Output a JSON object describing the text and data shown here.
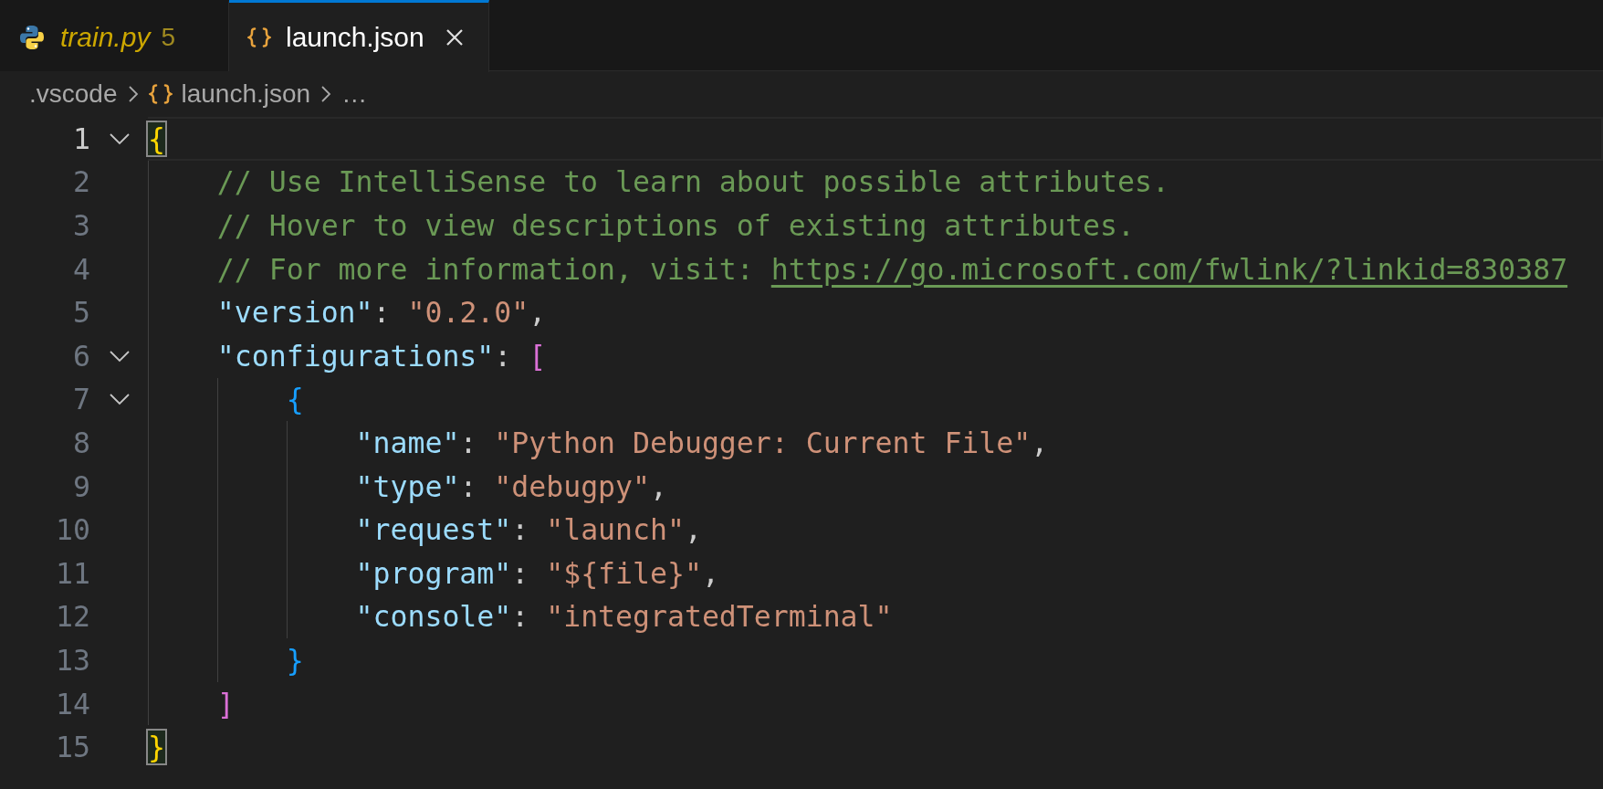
{
  "tabs": [
    {
      "label": "train.py",
      "kind": "python",
      "badge": "5",
      "preview": true,
      "selected": false,
      "closable": false
    },
    {
      "label": "launch.json",
      "kind": "json",
      "preview": false,
      "selected": true,
      "closable": true
    }
  ],
  "breadcrumb": [
    {
      "label": ".vscode",
      "kind": "folder"
    },
    {
      "label": "launch.json",
      "kind": "json"
    },
    {
      "label": "…",
      "kind": "symbols"
    }
  ],
  "lines": [
    {
      "number": "1",
      "fold": true,
      "current": true,
      "tokens": [
        {
          "kind": "bracket1",
          "text": "{",
          "matched": true
        }
      ]
    },
    {
      "number": "2",
      "fold": false,
      "current": false,
      "tokens": [
        {
          "kind": "comment",
          "text": "    // Use IntelliSense to learn about possible attributes."
        }
      ]
    },
    {
      "number": "3",
      "fold": false,
      "current": false,
      "tokens": [
        {
          "kind": "comment",
          "text": "    // Hover to view descriptions of existing attributes."
        }
      ]
    },
    {
      "number": "4",
      "fold": false,
      "current": false,
      "tokens": [
        {
          "kind": "comment",
          "text": "    // For more information, visit: "
        },
        {
          "kind": "link",
          "text": "https://go.microsoft.com/fwlink/?linkid=830387"
        }
      ]
    },
    {
      "number": "5",
      "fold": false,
      "current": false,
      "tokens": [
        {
          "kind": "key",
          "text": "    \"version\""
        },
        {
          "kind": "punct",
          "text": ": "
        },
        {
          "kind": "string",
          "text": "\"0.2.0\""
        },
        {
          "kind": "punct",
          "text": ","
        }
      ]
    },
    {
      "number": "6",
      "fold": true,
      "current": false,
      "tokens": [
        {
          "kind": "key",
          "text": "    \"configurations\""
        },
        {
          "kind": "punct",
          "text": ": "
        },
        {
          "kind": "bracket2",
          "text": "["
        }
      ]
    },
    {
      "number": "7",
      "fold": true,
      "current": false,
      "tokens": [
        {
          "kind": "bracket3",
          "text": "        {"
        }
      ]
    },
    {
      "number": "8",
      "fold": false,
      "current": false,
      "tokens": [
        {
          "kind": "key",
          "text": "            \"name\""
        },
        {
          "kind": "punct",
          "text": ": "
        },
        {
          "kind": "string",
          "text": "\"Python Debugger: Current File\""
        },
        {
          "kind": "punct",
          "text": ","
        }
      ]
    },
    {
      "number": "9",
      "fold": false,
      "current": false,
      "tokens": [
        {
          "kind": "key",
          "text": "            \"type\""
        },
        {
          "kind": "punct",
          "text": ": "
        },
        {
          "kind": "string",
          "text": "\"debugpy\""
        },
        {
          "kind": "punct",
          "text": ","
        }
      ]
    },
    {
      "number": "10",
      "fold": false,
      "current": false,
      "tokens": [
        {
          "kind": "key",
          "text": "            \"request\""
        },
        {
          "kind": "punct",
          "text": ": "
        },
        {
          "kind": "string",
          "text": "\"launch\""
        },
        {
          "kind": "punct",
          "text": ","
        }
      ]
    },
    {
      "number": "11",
      "fold": false,
      "current": false,
      "tokens": [
        {
          "kind": "key",
          "text": "            \"program\""
        },
        {
          "kind": "punct",
          "text": ": "
        },
        {
          "kind": "string",
          "text": "\"${file}\""
        },
        {
          "kind": "punct",
          "text": ","
        }
      ]
    },
    {
      "number": "12",
      "fold": false,
      "current": false,
      "tokens": [
        {
          "kind": "key",
          "text": "            \"console\""
        },
        {
          "kind": "punct",
          "text": ": "
        },
        {
          "kind": "string",
          "text": "\"integratedTerminal\""
        }
      ]
    },
    {
      "number": "13",
      "fold": false,
      "current": false,
      "tokens": [
        {
          "kind": "bracket3",
          "text": "        }"
        }
      ]
    },
    {
      "number": "14",
      "fold": false,
      "current": false,
      "tokens": [
        {
          "kind": "bracket2",
          "text": "    ]"
        }
      ]
    },
    {
      "number": "15",
      "fold": false,
      "current": false,
      "tokens": [
        {
          "kind": "bracket1",
          "text": "}",
          "matched": true
        }
      ]
    }
  ]
}
